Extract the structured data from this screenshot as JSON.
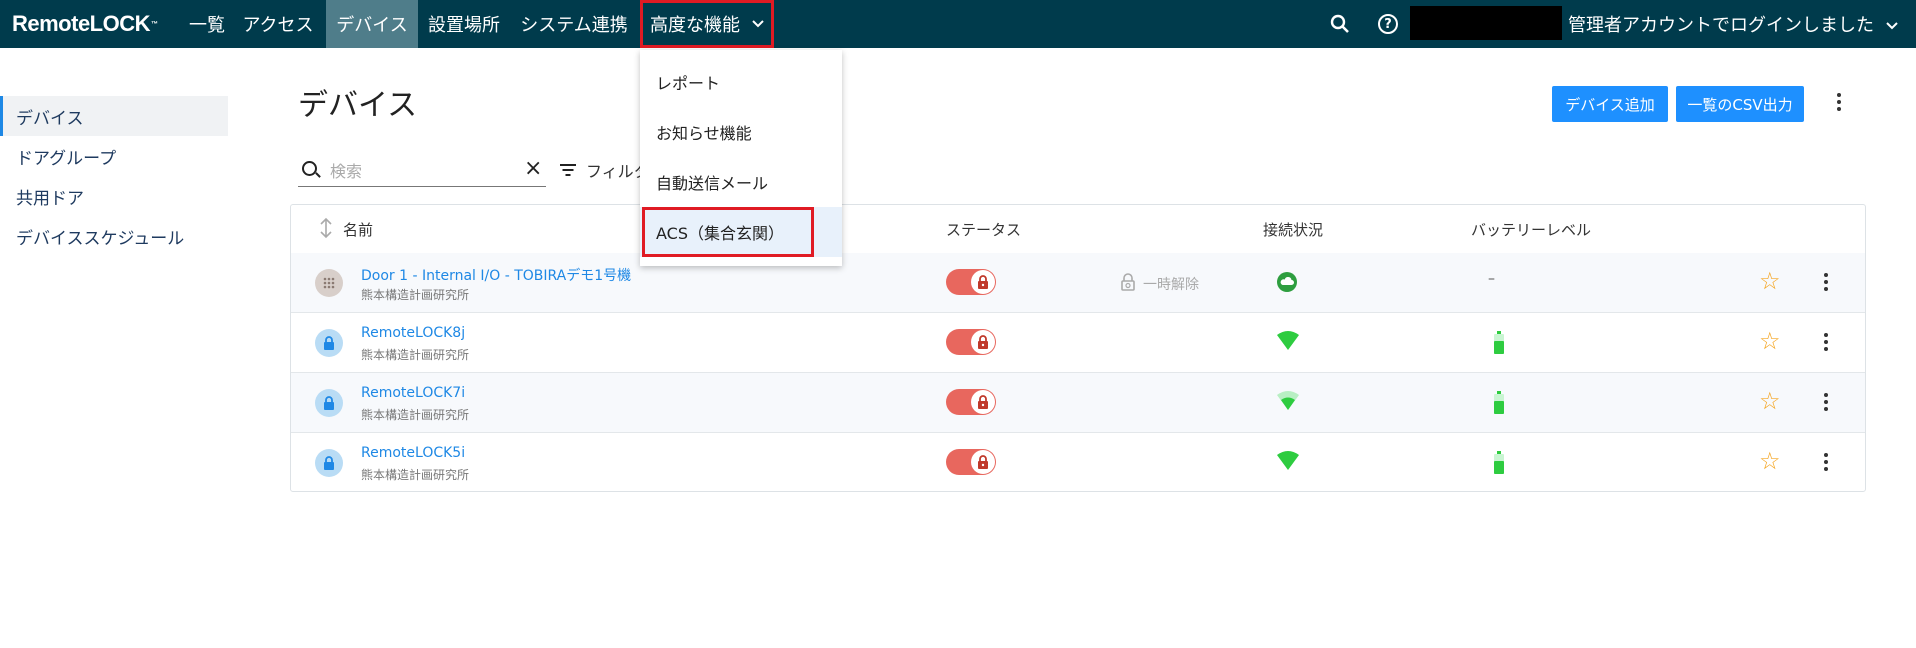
{
  "brand": {
    "logo_text": "RemoteLOCK",
    "logo_tm": "™"
  },
  "nav": {
    "items": [
      {
        "label": "一覧"
      },
      {
        "label": "アクセス"
      },
      {
        "label": "デバイス"
      },
      {
        "label": "設置場所"
      },
      {
        "label": "システム連携"
      },
      {
        "label": "高度な機能"
      }
    ],
    "active_index": 2,
    "user_label": "管理者アカウントでログインしました",
    "help_glyph": "?"
  },
  "advanced_menu": {
    "items": [
      {
        "label": "レポート"
      },
      {
        "label": "お知らせ機能"
      },
      {
        "label": "自動送信メール"
      },
      {
        "label": "ACS（集合玄関）"
      }
    ]
  },
  "sidebar": {
    "items": [
      {
        "label": "デバイス"
      },
      {
        "label": "ドアグループ"
      },
      {
        "label": "共用ドア"
      },
      {
        "label": "デバイススケジュール"
      }
    ]
  },
  "main": {
    "title": "デバイス",
    "add_device_label": "デバイス追加",
    "export_csv_label": "一覧のCSV出力",
    "search_placeholder": "検索",
    "filter_label": "フィルタ"
  },
  "table": {
    "columns": {
      "name": "名前",
      "status": "ステータス",
      "connection": "接続状況",
      "battery": "バッテリーレベル"
    },
    "rows": [
      {
        "name": "Door 1 - Internal I/O - TOBIRAデモ1号機",
        "location": "熊本構造計画研究所",
        "icon": "keypad-icon",
        "status": "locked",
        "temp_unlock_label": "一時解除",
        "connection": "cloud",
        "battery": "–",
        "favorite": false
      },
      {
        "name": "RemoteLOCK8j",
        "location": "熊本構造計画研究所",
        "icon": "lock-icon",
        "status": "locked",
        "connection": "wifi-strong",
        "battery": "battery-full",
        "favorite": false
      },
      {
        "name": "RemoteLOCK7i",
        "location": "熊本構造計画研究所",
        "icon": "lock-icon",
        "status": "locked",
        "connection": "wifi-medium",
        "battery": "battery-full",
        "favorite": false
      },
      {
        "name": "RemoteLOCK5i",
        "location": "熊本構造計画研究所",
        "icon": "lock-icon",
        "status": "locked",
        "connection": "wifi-strong",
        "battery": "battery-full",
        "favorite": false
      }
    ]
  },
  "colors": {
    "nav_bg": "#003b4c",
    "nav_active": "#4f7d8a",
    "primary": "#1e90ff",
    "link": "#1e88e5",
    "toggle_locked": "#e8675e",
    "highlight_border": "#e01b24",
    "connection_green": "#2ecc40",
    "star": "#f5a623"
  }
}
